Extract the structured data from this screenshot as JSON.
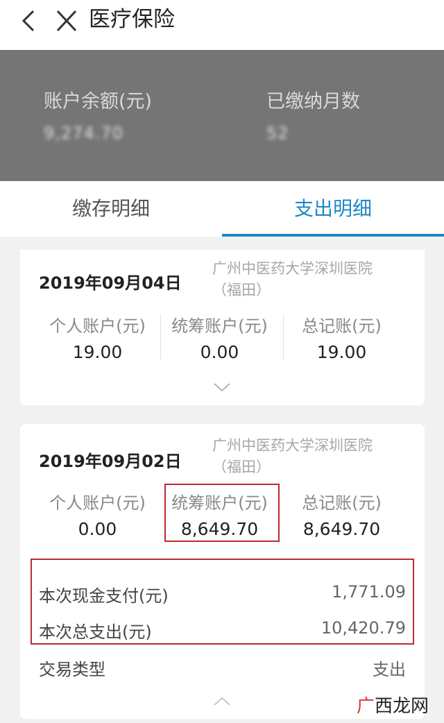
{
  "header": {
    "title": "医疗保险"
  },
  "summary": {
    "balance_label": "账户余额(元)",
    "balance_value": "9,274.70",
    "months_label": "已缴纳月数",
    "months_value": "52"
  },
  "tabs": [
    {
      "label": "缴存明细",
      "active": false
    },
    {
      "label": "支出明细",
      "active": true
    }
  ],
  "records": [
    {
      "date": "2019年09月04日",
      "hospital": "广州中医药大学深圳医院（福田）",
      "cols": [
        {
          "label": "个人账户(元)",
          "value": "19.00"
        },
        {
          "label": "统筹账户(元)",
          "value": "0.00"
        },
        {
          "label": "总记账(元)",
          "value": "19.00"
        }
      ],
      "expanded": false
    },
    {
      "date": "2019年09月02日",
      "hospital": "广州中医药大学深圳医院（福田）",
      "cols": [
        {
          "label": "个人账户(元)",
          "value": "0.00"
        },
        {
          "label": "统筹账户(元)",
          "value": "8,649.70"
        },
        {
          "label": "总记账(元)",
          "value": "8,649.70"
        }
      ],
      "details": [
        {
          "label": "本次现金支付(元)",
          "value": "1,771.09"
        },
        {
          "label": "本次总支出(元)",
          "value": "10,420.79"
        },
        {
          "label": "交易类型",
          "value": "支出"
        }
      ],
      "expanded": true
    }
  ],
  "watermark": {
    "char1": "广",
    "char2": "西龙网"
  },
  "colors": {
    "accent": "#1e88c8",
    "highlight": "#c0282e",
    "summary_bg": "#757575"
  }
}
